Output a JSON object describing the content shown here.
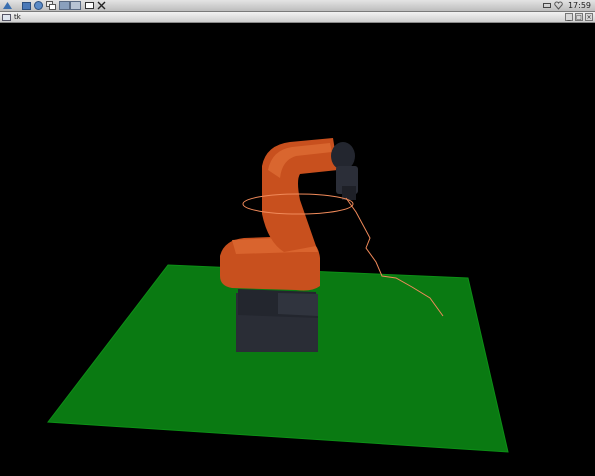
{
  "panel": {
    "clock": "17:59",
    "launchers": [
      "app-menu-icon",
      "file-manager-icon",
      "browser-icon",
      "windows-icon",
      "workspace-1",
      "workspace-2",
      "show-desktop-icon",
      "x-terminal-icon"
    ]
  },
  "window": {
    "title": "tk",
    "buttons": {
      "minimize": "_",
      "maximize": "□",
      "close": "×"
    }
  },
  "scene": {
    "background": "#000000",
    "floor_color": "#0a7a12",
    "robot_color": "#c8501e",
    "base_color": "#2a2d36",
    "trajectory_color": "#f08a5a"
  }
}
